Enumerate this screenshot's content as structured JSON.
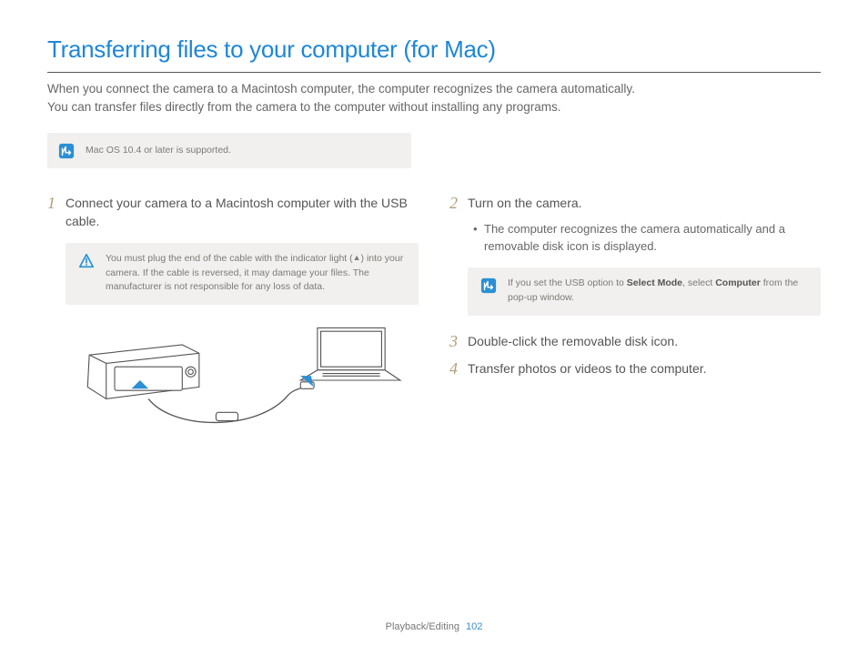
{
  "title": "Transferring files to your computer (for Mac)",
  "intro_line1": "When you connect the camera to a Macintosh computer, the computer recognizes the camera automatically.",
  "intro_line2": "You can transfer files directly from the camera to the computer without installing any programs.",
  "support_note": "Mac OS 10.4 or later is supported.",
  "steps": {
    "s1": {
      "num": "1",
      "text": "Connect your camera to a Macintosh computer with the USB cable.",
      "warning_pre": "You must plug the end of the cable with the indicator light (",
      "warning_post": ") into your camera. If the cable is reversed, it may damage your files. The manufacturer is not responsible for any loss of data."
    },
    "s2": {
      "num": "2",
      "text": "Turn on the camera.",
      "bullet": "The computer recognizes the camera automatically and a removable disk icon is displayed.",
      "note_pre": "If you set the USB option to ",
      "note_bold1": "Select Mode",
      "note_mid": ", select ",
      "note_bold2": "Computer",
      "note_post": " from the pop-up window."
    },
    "s3": {
      "num": "3",
      "text": "Double-click the removable disk icon."
    },
    "s4": {
      "num": "4",
      "text": "Transfer photos or videos to the computer."
    }
  },
  "footer": {
    "section": "Playback/Editing",
    "page": "102"
  }
}
